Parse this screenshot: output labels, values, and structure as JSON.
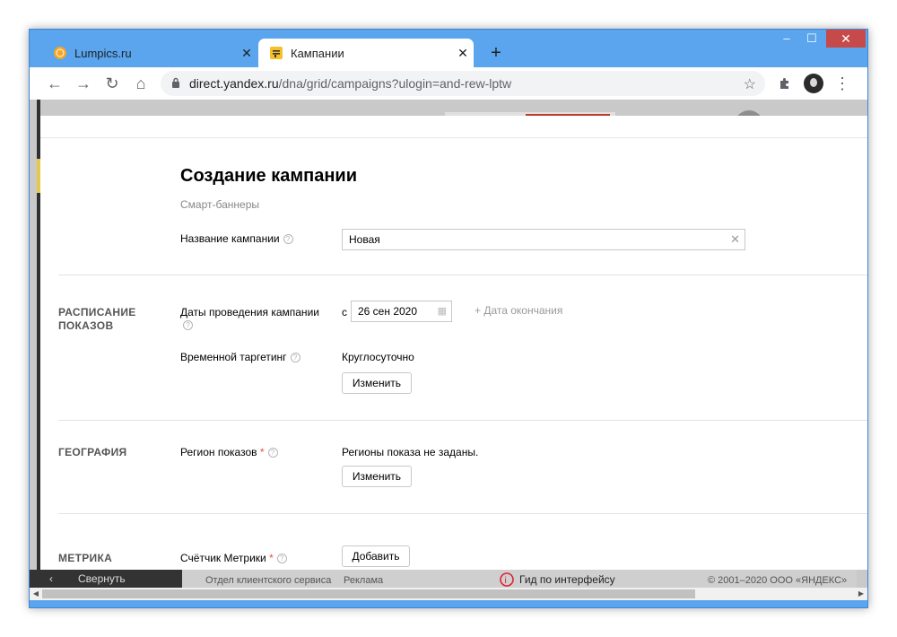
{
  "window": {
    "minimize": "–",
    "maximize": "☐",
    "close": "✕"
  },
  "tabs": [
    {
      "title": "Lumpics.ru",
      "close": "✕"
    },
    {
      "title": "Кампании",
      "close": "✕"
    }
  ],
  "new_tab": "+",
  "toolbar": {
    "back": "←",
    "forward": "→",
    "reload": "↻",
    "home": "⌂",
    "url_host": "direct.yandex.ru",
    "url_path": "/dna/grid/campaigns?ulogin=and-rew-lptw",
    "star": "☆",
    "menu": "⋮"
  },
  "form": {
    "title": "Создание кампании",
    "subtitle": "Смарт-баннеры",
    "name_label": "Название кампании",
    "name_value": "Новая",
    "clear_icon": "✕",
    "help": "?",
    "schedule": {
      "section": "РАСПИСАНИЕ ПОКАЗОВ",
      "dates_label": "Даты проведения кампании",
      "from_prefix": "с",
      "start_date": "26 сен 2020",
      "add_end_date": "+ Дата окончания",
      "time_label": "Временной таргетинг",
      "time_value": "Круглосуточно",
      "change_button": "Изменить"
    },
    "geo": {
      "section": "ГЕОГРАФИЯ",
      "region_label": "Регион показов",
      "region_value": "Регионы показа не заданы.",
      "change_button": "Изменить"
    },
    "metrika": {
      "section": "МЕТРИКА",
      "counter_label": "Счётчик Метрики",
      "add_button": "Добавить"
    },
    "required_mark": "*"
  },
  "footer": {
    "collapse": "Свернуть",
    "links": [
      "Отдел клиентского сервиса",
      "Реклама"
    ],
    "guide": "Гид по интерфейсу",
    "copyright": "© 2001–2020 ООО «ЯНДЕКС»"
  }
}
